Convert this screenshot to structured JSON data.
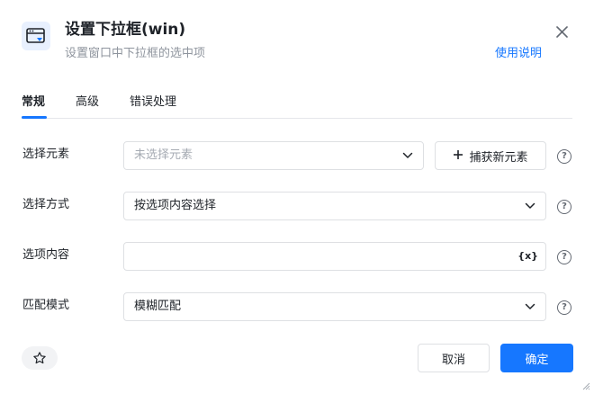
{
  "header": {
    "icon": "dropdown-window-icon",
    "title": "设置下拉框(win)",
    "subtitle": "设置窗口中下拉框的选中项",
    "help_link": "使用说明",
    "close_icon": "close-icon"
  },
  "tabs": [
    {
      "label": "常规",
      "active": true
    },
    {
      "label": "高级",
      "active": false
    },
    {
      "label": "错误处理",
      "active": false
    }
  ],
  "form": {
    "element": {
      "label": "选择元素",
      "placeholder": "未选择元素",
      "capture_button": "捕获新元素"
    },
    "method": {
      "label": "选择方式",
      "value": "按选项内容选择"
    },
    "option_content": {
      "label": "选项内容",
      "value": "",
      "variable_button": "{x}"
    },
    "match_mode": {
      "label": "匹配模式",
      "value": "模糊匹配"
    }
  },
  "footer": {
    "favorite_icon": "star-icon",
    "cancel_label": "取消",
    "confirm_label": "确定"
  },
  "colors": {
    "accent": "#1677ff",
    "border": "#dee0e3",
    "text": "#1f2329",
    "muted": "#8f959e"
  }
}
